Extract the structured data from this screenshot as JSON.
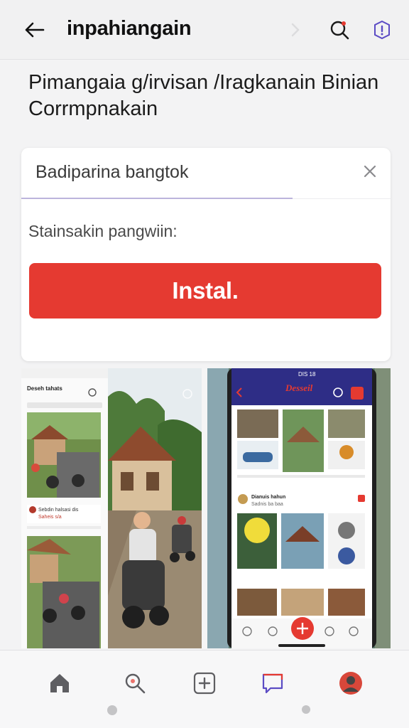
{
  "header": {
    "title": "inpahiangain",
    "icons": {
      "back": "arrow-left-icon",
      "forward": "chevron-right-icon",
      "search": "search-icon",
      "info": "info-icon"
    }
  },
  "headline": {
    "line1": "Pimangaia g/irvisan /Iragkanain Binian",
    "line2": "Corrmpnakain"
  },
  "install_card": {
    "search_value": "Badiparina bangtok",
    "label": "Stainsakin pangwiin:",
    "install_label": "Instal.",
    "clear_icon": "close-icon"
  },
  "screenshots": {
    "shot1": {
      "title": "Deseh tahats",
      "caption": "Sebdin halsasi dis",
      "caption2": "Saheis s/a"
    },
    "shot3": {
      "status_time": "DIS 18",
      "title": "Desseil",
      "feed_title": "Dianuis hahun",
      "feed_sub": "Sadnis ba baa"
    }
  },
  "bottom_nav": [
    {
      "name": "home",
      "icon": "home-icon"
    },
    {
      "name": "search",
      "icon": "search-icon"
    },
    {
      "name": "add",
      "icon": "add-square-icon"
    },
    {
      "name": "messages",
      "icon": "chat-icon"
    },
    {
      "name": "profile",
      "icon": "avatar-icon"
    }
  ],
  "colors": {
    "accent": "#e53a31",
    "brand_purple": "#5b4bc4",
    "header_bg": "#f1f1f2"
  }
}
